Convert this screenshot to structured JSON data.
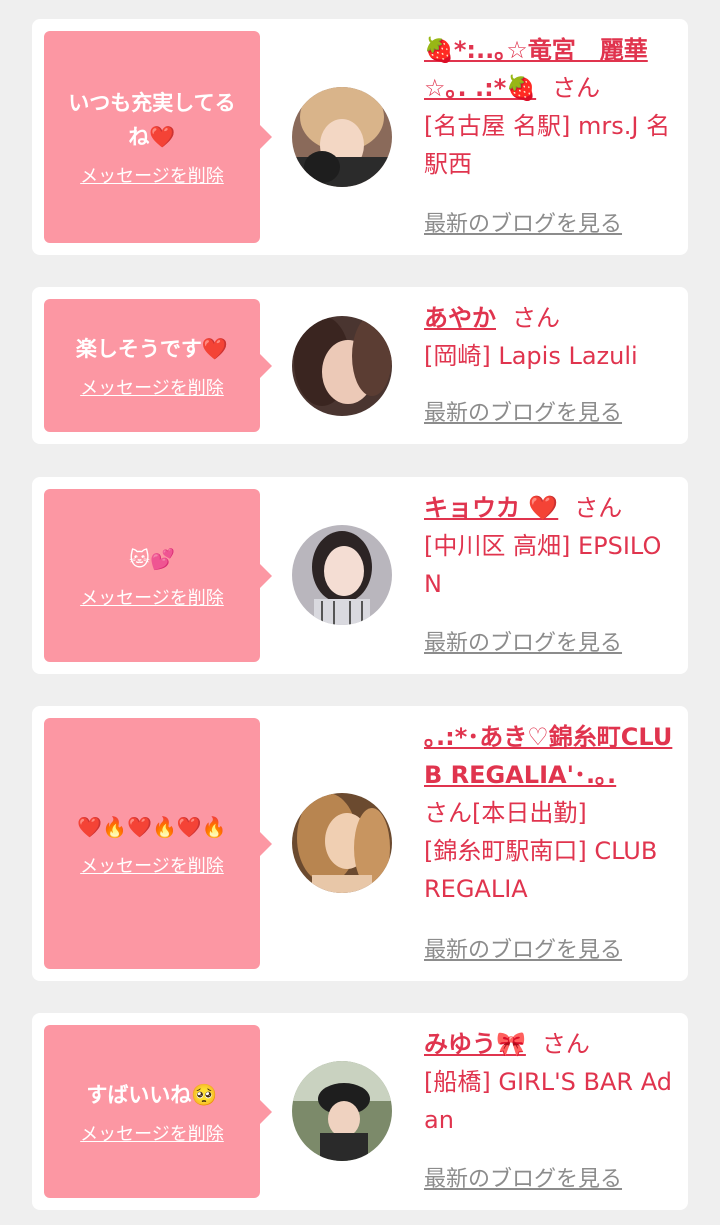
{
  "colors": {
    "page_bg": "#efefef",
    "card_bg": "#ffffff",
    "bubble_bg": "#fc97a3",
    "name_color": "#e0344e",
    "link_gray": "#8c8c8c"
  },
  "delete_label": "メッセージを削除",
  "blog_label": "最新のブログを見る",
  "san_label": "さん",
  "cards": [
    {
      "message": "いつも充実してるね❤️",
      "name": "🍓*:..｡☆竜宮　麗華☆｡. .:*🍓",
      "suffix": "さん",
      "shop": "[名古屋 名駅] mrs.J 名駅西",
      "avatar_icon": "avatar-photo"
    },
    {
      "message": "楽しそうです❤️",
      "name": "あやか",
      "suffix": "さん",
      "shop": "[岡崎] Lapis Lazuli",
      "avatar_icon": "avatar-photo"
    },
    {
      "message": "🐱💕",
      "name": "キョウカ ❤️",
      "suffix": "さん",
      "shop": "[中川区 高畑] EPSILON",
      "avatar_icon": "avatar-photo"
    },
    {
      "message": "❤️🔥❤️🔥❤️🔥",
      "name": "｡.:*･あき♡錦糸町CLUB REGALIA'･.｡.",
      "suffix": "さん[本日出勤]",
      "shop": "[錦糸町駅南口] CLUB REGALIA",
      "avatar_icon": "avatar-photo"
    },
    {
      "message": "すばいいね🥺",
      "name": "みゆう🎀",
      "suffix": "さん",
      "shop": "[船橋] GIRL'S BAR Adan",
      "avatar_icon": "avatar-photo"
    }
  ]
}
